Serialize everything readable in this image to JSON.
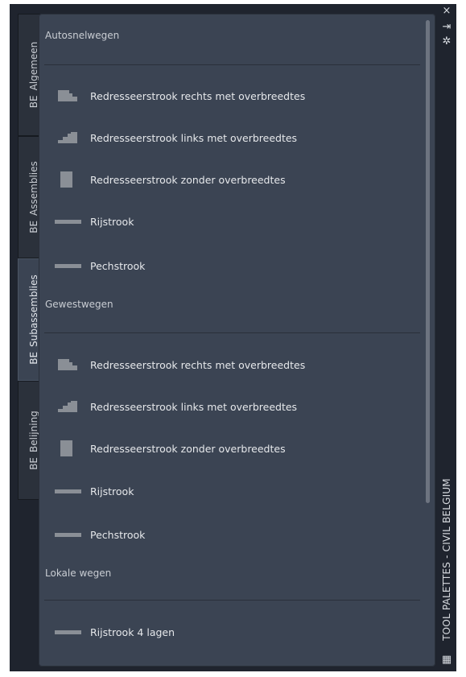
{
  "tabs": [
    {
      "label": "BE_Algemeen",
      "active": false
    },
    {
      "label": "BE_Assemblies",
      "active": false
    },
    {
      "label": "BE_Subassemblies",
      "active": true
    },
    {
      "label": "BE_Belijning",
      "active": false
    }
  ],
  "palette_title": "TOOL PALETTES - CIVIL BELGIUM",
  "strip_buttons": {
    "close": "×",
    "autohide": "⇥",
    "properties": "✲",
    "menu": "▦"
  },
  "sections": [
    {
      "title": "Autosnelwegen",
      "items": [
        {
          "label": "Redresseerstrook rechts met overbreedtes",
          "icon": "superelevation-right-icon"
        },
        {
          "label": "Redresseerstrook links met overbreedtes",
          "icon": "superelevation-left-icon"
        },
        {
          "label": "Redresseerstrook zonder overbreedtes",
          "icon": "superelevation-none-icon"
        },
        {
          "label": "Rijstrook",
          "icon": "lane-icon"
        },
        {
          "label": "Pechstrook",
          "icon": "shoulder-icon"
        }
      ]
    },
    {
      "title": "Gewestwegen",
      "items": [
        {
          "label": "Redresseerstrook rechts met overbreedtes",
          "icon": "superelevation-right-icon"
        },
        {
          "label": "Redresseerstrook links met overbreedtes",
          "icon": "superelevation-left-icon"
        },
        {
          "label": "Redresseerstrook zonder overbreedtes",
          "icon": "superelevation-none-icon"
        },
        {
          "label": "Rijstrook",
          "icon": "lane-icon"
        },
        {
          "label": "Pechstrook",
          "icon": "shoulder-icon"
        }
      ]
    },
    {
      "title": "Lokale wegen",
      "items": [
        {
          "label": "Rijstrook 4 lagen",
          "icon": "lane-icon"
        }
      ]
    }
  ],
  "colors": {
    "frame": "#1f242e",
    "panel": "#3b4453",
    "icon": "#8a8f96",
    "text": "#e6e8eb"
  }
}
